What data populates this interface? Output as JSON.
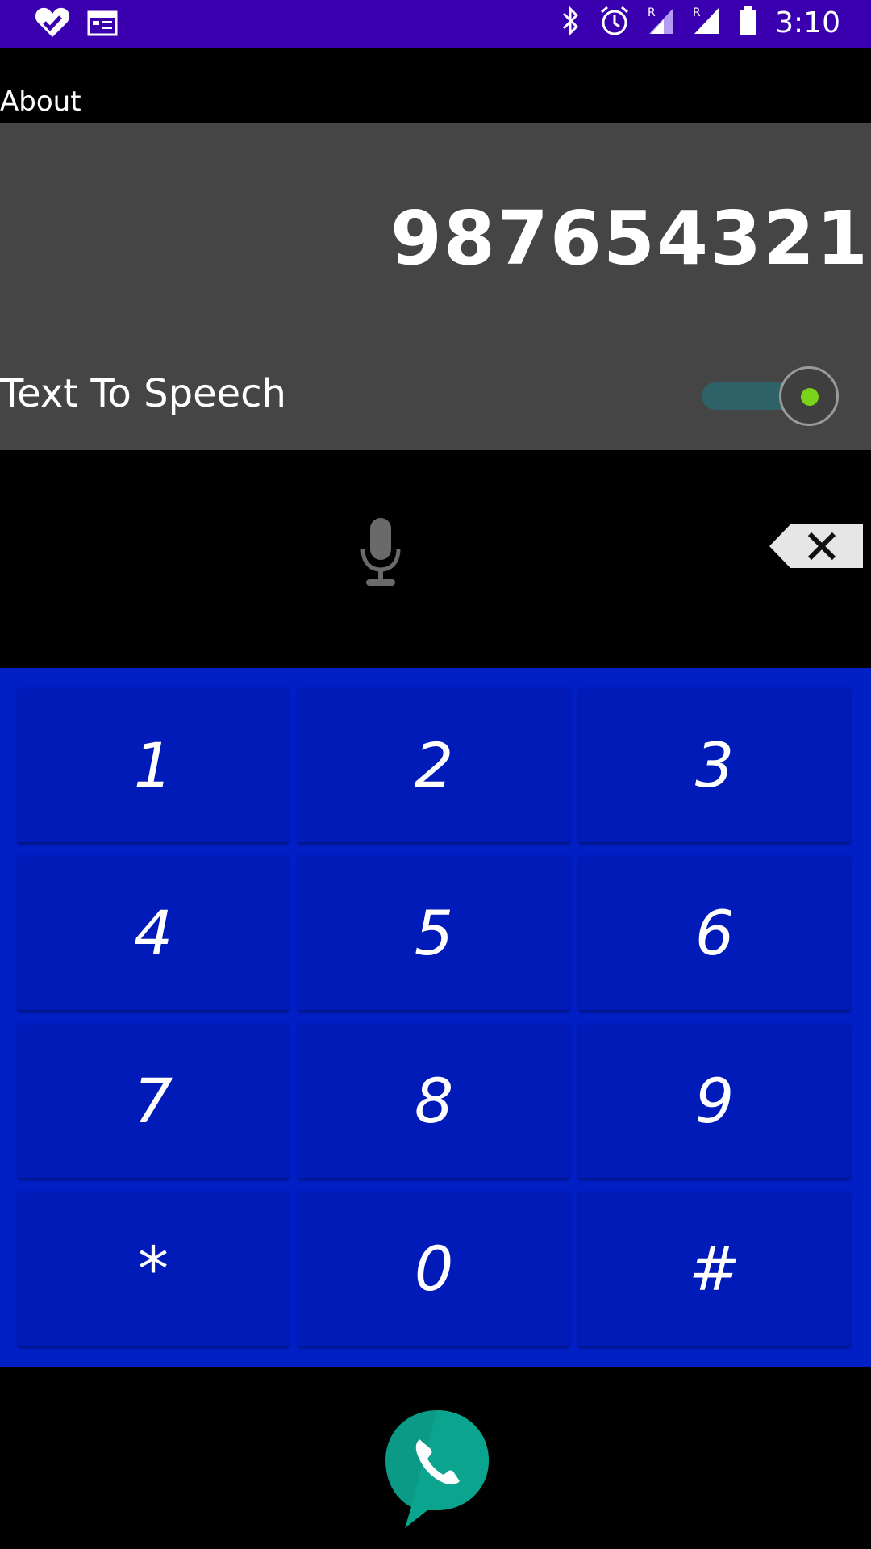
{
  "status_bar": {
    "time": "3:10",
    "left_icons": [
      "heart-check-icon",
      "calendar-icon"
    ],
    "right_icons": [
      "bluetooth-icon",
      "alarm-icon",
      "signal-r-icon",
      "signal-r-icon",
      "battery-icon"
    ],
    "background": "#3a00b0"
  },
  "header": {
    "about_label": "About"
  },
  "display": {
    "number": "987654321",
    "tts_label": "Text To Speech",
    "tts_enabled": true,
    "background": "#454545"
  },
  "controls": {
    "mic_icon": "microphone-icon",
    "backspace_icon": "backspace-icon"
  },
  "keypad": {
    "keys": [
      "1",
      "2",
      "3",
      "4",
      "5",
      "6",
      "7",
      "8",
      "9",
      "*",
      "0",
      "#"
    ],
    "background": "#001fc4"
  },
  "call": {
    "icon": "phone-call-icon",
    "color": "#0a9a86"
  }
}
